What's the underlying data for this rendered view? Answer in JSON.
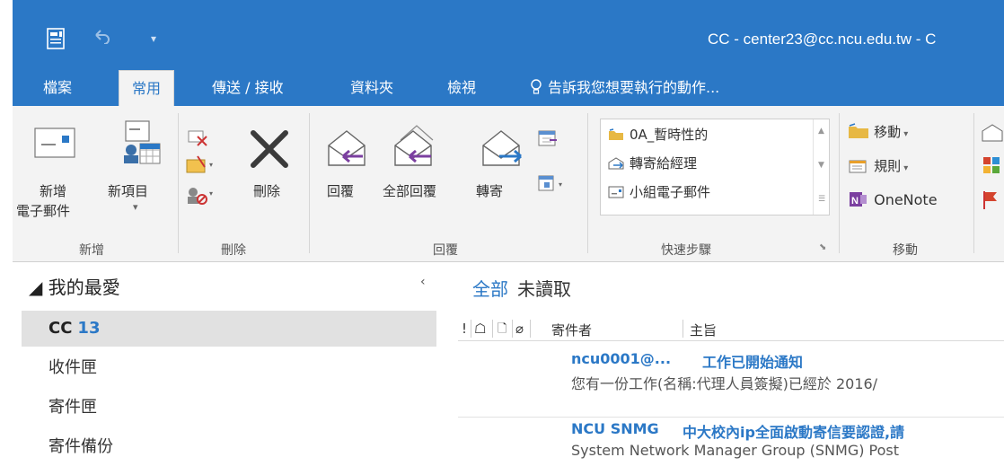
{
  "window": {
    "title": "CC - center23@cc.ncu.edu.tw - C"
  },
  "qat": {
    "dropdown": "▾"
  },
  "tabs": [
    {
      "label": "檔案"
    },
    {
      "label": "常用"
    },
    {
      "label": "傳送 / 接收"
    },
    {
      "label": "資料夾"
    },
    {
      "label": "檢視"
    },
    {
      "label": "告訴我您想要執行的動作..."
    }
  ],
  "ribbon": {
    "new_group": {
      "new_email": [
        "新增",
        "電子郵件"
      ],
      "new_item": "新項目",
      "new_item_drop": "▾",
      "label": "新增"
    },
    "delete_group": {
      "delete": "刪除",
      "label": "刪除"
    },
    "respond_group": {
      "reply": "回覆",
      "reply_all": "全部回覆",
      "forward": "轉寄",
      "label": "回覆"
    },
    "quick_steps": {
      "items": [
        "0A_暫時性的",
        "轉寄給經理",
        "小組電子郵件"
      ],
      "label": "快速步驟"
    },
    "move_group": {
      "move": "移動",
      "rules": "規則",
      "onenote": "OneNote",
      "label": "移動"
    }
  },
  "nav": {
    "favorites": "◢ 我的最愛",
    "collapse": "‹",
    "folders": [
      {
        "name": "CC",
        "count": "13",
        "selected": true
      },
      {
        "name": "收件匣",
        "count": ""
      },
      {
        "name": "寄件匣",
        "count": ""
      },
      {
        "name": "寄件備份",
        "count": ""
      }
    ]
  },
  "list": {
    "filters": {
      "all": "全部",
      "unread": "未讀取"
    },
    "columns": {
      "importance": "!",
      "reminder": "☖",
      "icon": "🗋",
      "attach": "⌀",
      "from": "寄件者",
      "subject": "主旨"
    },
    "messages": [
      {
        "from": "ncu0001@...",
        "subject": "工作已開始通知",
        "preview": "您有一份工作(名稱:代理人員簽擬)已經於   2016/"
      },
      {
        "from": "NCU SNMG",
        "subject": "中大校內ip全面啟動寄信要認證,請",
        "preview": "System Network Manager Group (SNMG) Post"
      }
    ]
  },
  "colors": {
    "accent": "#2b78c6",
    "ribbon": "#f3f3f3"
  }
}
